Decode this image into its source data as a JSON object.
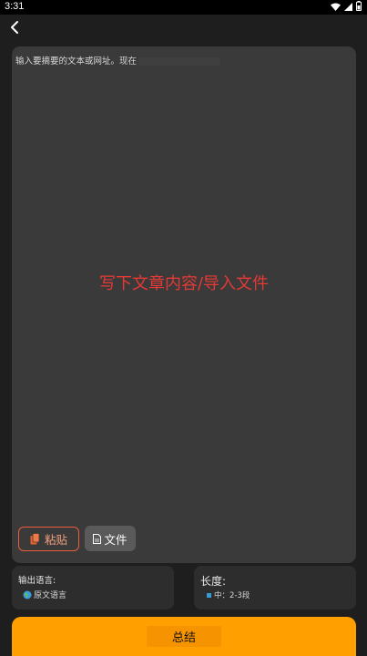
{
  "status_bar": {
    "time": "3:31",
    "icons": [
      "wifi-icon",
      "signal-icon",
      "battery-icon"
    ]
  },
  "header": {
    "back_icon": "chevron-left-icon"
  },
  "editor": {
    "placeholder": "输入要摘要的文本或网址。现在",
    "hint": "写下文章内容/导入文件",
    "hint_color": "#e53935",
    "paste_label": "粘贴",
    "file_label": "文件"
  },
  "output_language": {
    "label": "输出语言:",
    "value": "原文语言"
  },
  "length": {
    "label": "长度:",
    "value": "中：2-3段"
  },
  "summarize": {
    "label": "总结",
    "color": "#ffa000"
  }
}
